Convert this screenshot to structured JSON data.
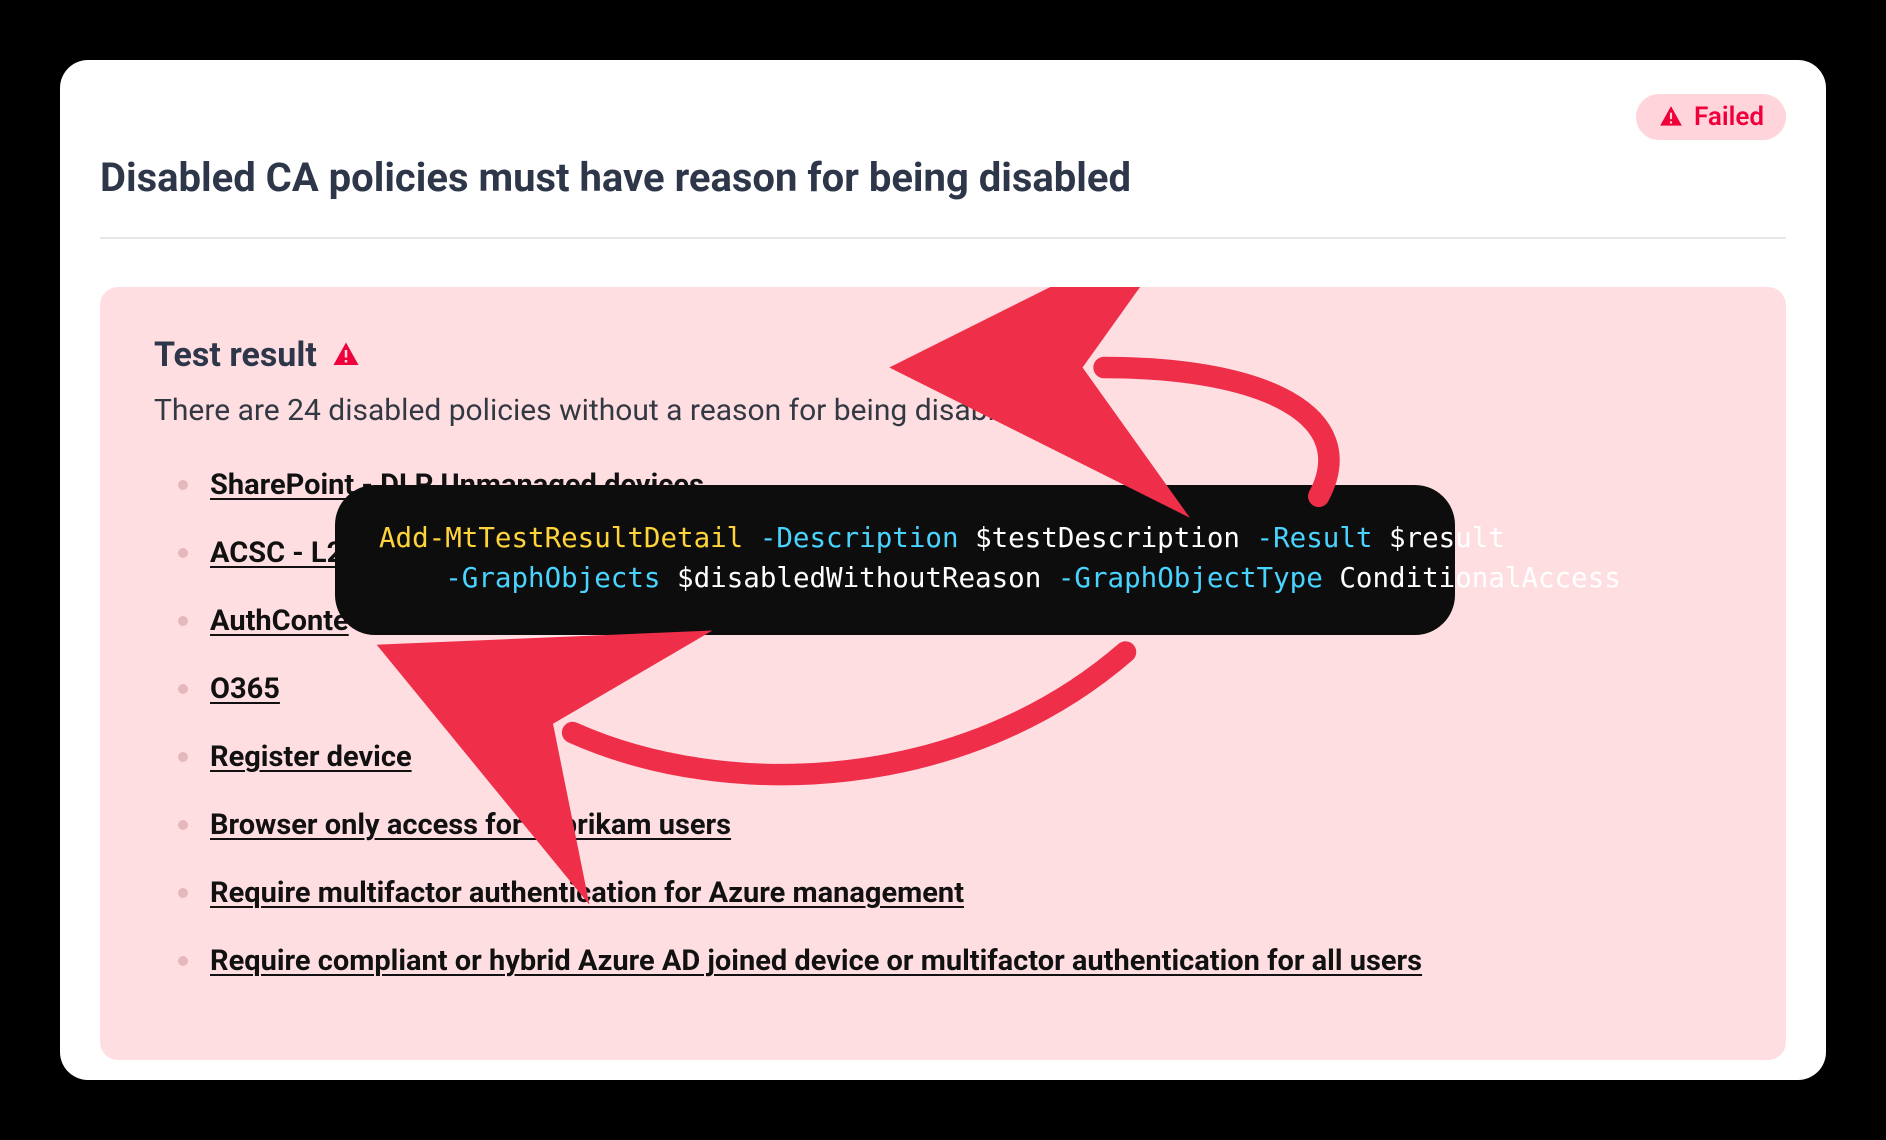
{
  "status": {
    "label": "Failed"
  },
  "page": {
    "title": "Disabled CA policies must have reason for being disabled"
  },
  "result": {
    "heading": "Test result",
    "summary": "There are 24 disabled policies without a reason for being disabled.",
    "policies": [
      "SharePoint - DLP Unmanaged devices",
      "ACSC - L2",
      "AuthConte",
      "O365",
      "Register device",
      "Browser only access for Fabrikam users",
      "Require multifactor authentication for Azure management",
      "Require compliant or hybrid Azure AD joined device or multifactor authentication for all users"
    ]
  },
  "code": {
    "cmdlet": "Add-MtTestResultDetail",
    "params": [
      {
        "name": "-Description",
        "value": "$testDescription"
      },
      {
        "name": "-Result",
        "value": "$result"
      },
      {
        "name": "-GraphObjects",
        "value": "$disabledWithoutReason"
      },
      {
        "name": "-GraphObjectType",
        "value": "ConditionalAccess"
      }
    ]
  }
}
